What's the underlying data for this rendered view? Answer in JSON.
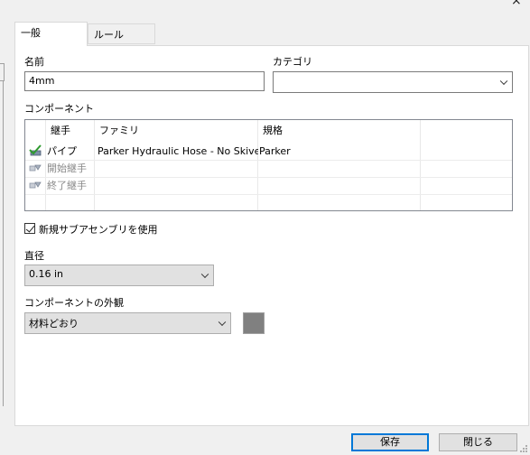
{
  "window": {
    "close_glyph": "×"
  },
  "tabs": [
    {
      "label": "一般"
    },
    {
      "label": "ルール"
    }
  ],
  "name": {
    "label": "名前",
    "value": "4mm"
  },
  "category": {
    "label": "カテゴリ",
    "value": ""
  },
  "components": {
    "label": "コンポーネント",
    "columns": [
      "継手",
      "ファミリ",
      "規格"
    ],
    "rows": [
      {
        "joint": "パイプ",
        "family": "Parker Hydraulic Hose - No Skive",
        "standard": "Parker",
        "enabled": true
      },
      {
        "joint": "開始継手",
        "family": "",
        "standard": "",
        "enabled": false
      },
      {
        "joint": "終了継手",
        "family": "",
        "standard": "",
        "enabled": false
      }
    ]
  },
  "new_subassembly": {
    "label": "新規サブアセンブリを使用",
    "checked": true
  },
  "diameter": {
    "label": "直径",
    "value": "0.16 in"
  },
  "appearance": {
    "label": "コンポーネントの外観",
    "value": "材料どおり",
    "swatch_color": "#808080"
  },
  "buttons": {
    "save": "保存",
    "close": "閉じる"
  }
}
